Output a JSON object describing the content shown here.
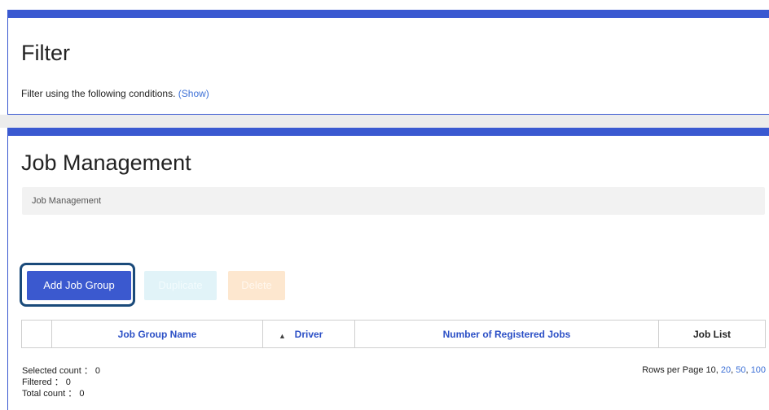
{
  "filter": {
    "title": "Filter",
    "description": "Filter using the following conditions.",
    "show_link": "(Show)"
  },
  "job_management": {
    "title": "Job Management",
    "breadcrumb": "Job Management",
    "buttons": {
      "add": "Add Job Group",
      "duplicate": "Duplicate",
      "delete": "Delete"
    },
    "table": {
      "columns": [
        "",
        "Job Group Name",
        "Driver",
        "Number of Registered Jobs",
        "Job List"
      ],
      "rows": []
    },
    "counts": {
      "selected": "Selected count ： 0",
      "filtered": "Filtered ： 0",
      "total": "Total count ： 0"
    },
    "rows_per_page": {
      "label": "Rows per Page",
      "current": "10",
      "sep1": ",",
      "opt20": "20",
      "sep2": ",",
      "opt50": "50",
      "sep3": ",",
      "opt100": "100"
    }
  },
  "colors": {
    "accent": "#3a59d1",
    "link": "#3b6fd6",
    "highlight_border": "#1a4a7a"
  }
}
